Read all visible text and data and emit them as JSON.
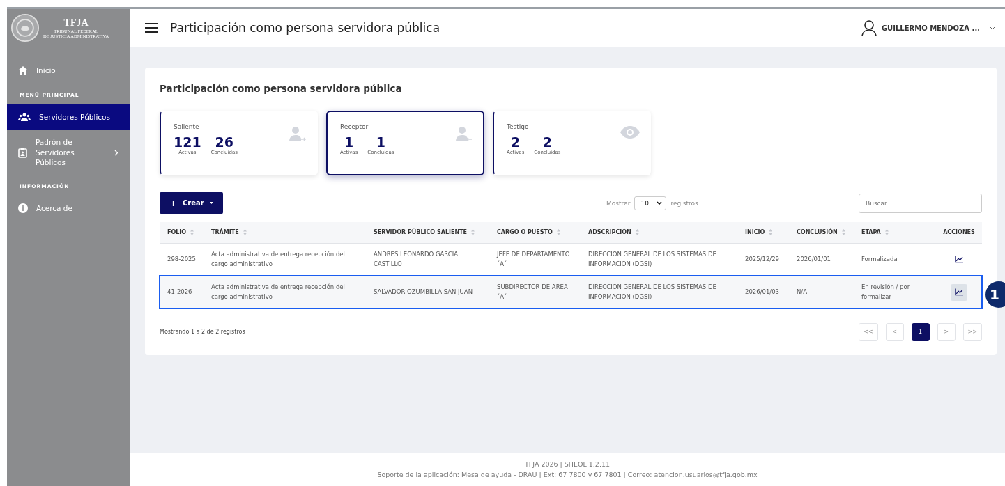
{
  "sidebar": {
    "logo": {
      "title": "TFJA",
      "subtitle_1": "TRIBUNAL FEDERAL",
      "subtitle_2": "DE JUSTICIA ADMINISTRATIVA"
    },
    "items": [
      {
        "kind": "link",
        "label": "Inicio",
        "selected": false
      },
      {
        "kind": "section",
        "label": "MENÚ PRINCIPAL"
      },
      {
        "kind": "link",
        "label": "Servidores Públicos",
        "selected": true
      },
      {
        "kind": "submenu",
        "label": "Padrón de Servidores Públicos",
        "selected": false,
        "expanded": false
      },
      {
        "kind": "section",
        "label": "INFORMACIÓN"
      },
      {
        "kind": "link",
        "label": "Acerca de",
        "selected": false
      }
    ]
  },
  "header": {
    "title": "Participación como persona servidora pública",
    "user": "GUILLERMO MENDOZA ..."
  },
  "card": {
    "title": "Participación como persona servidora pública",
    "stats": [
      {
        "label": "Saliente",
        "selected": false,
        "values": [
          {
            "value": "121",
            "caption": "Activas"
          },
          {
            "value": "26",
            "caption": "Concluidas"
          }
        ]
      },
      {
        "label": "Receptor",
        "selected": true,
        "values": [
          {
            "value": "1",
            "caption": "Activas"
          },
          {
            "value": "1",
            "caption": "Concluidas"
          }
        ]
      },
      {
        "label": "Testigo",
        "selected": false,
        "values": [
          {
            "value": "2",
            "caption": "Activas"
          },
          {
            "value": "2",
            "caption": "Concluidas"
          }
        ]
      }
    ],
    "create_button": {
      "icon": "+",
      "label": "Crear"
    },
    "show": {
      "prefix": "Mostrar",
      "value": "10",
      "suffix": "registros"
    },
    "search": {
      "placeholder": "Buscar..."
    },
    "table": {
      "columns": [
        {
          "label": "FOLIO",
          "sortable": true
        },
        {
          "label": "TRÁMITE",
          "sortable": true
        },
        {
          "label": "SERVIDOR PÚBLICO SALIENTE",
          "sortable": true
        },
        {
          "label": "CARGO O PUESTO",
          "sortable": true
        },
        {
          "label": "ADSCRIPCIÓN",
          "sortable": true
        },
        {
          "label": "INICIO",
          "sortable": true
        },
        {
          "label": "CONCLUSIÓN",
          "sortable": true
        },
        {
          "label": "ETAPA",
          "sortable": true
        },
        {
          "label": "ACCIONES",
          "sortable": false
        }
      ],
      "rows": [
        {
          "selected": false,
          "cells": [
            "298-2025",
            "Acta administrativa de entrega recepción del cargo administrativo",
            "ANDRES LEONARDO GARCIA CASTILLO",
            "JEFE DE DEPARTAMENTO ´A´",
            "DIRECCION GENERAL DE LOS SISTEMAS DE INFORMACION (DGSI)",
            "2025/12/29",
            "2026/01/01",
            "Formalizada"
          ]
        },
        {
          "selected": true,
          "cells": [
            "41-2026",
            "Acta administrativa de entrega recepción del cargo administrativo",
            "SALVADOR OZUMBILLA SAN JUAN",
            "SUBDIRECTOR DE AREA ´A´",
            "DIRECCION GENERAL DE LOS SISTEMAS DE INFORMACION (DGSI)",
            "2026/01/03",
            "N/A",
            "En revisión / por formalizar"
          ]
        }
      ]
    },
    "summary": "Mostrando 1 a 2 de 2 registros",
    "pagination": [
      {
        "label": "<<",
        "selected": false
      },
      {
        "label": "<",
        "selected": false
      },
      {
        "label": "1",
        "selected": true
      },
      {
        "label": ">",
        "selected": false
      },
      {
        "label": ">>",
        "selected": false
      }
    ]
  },
  "annotation": {
    "label": "1"
  },
  "footer": {
    "line_1": "TFJA 2026 | SHEOL 1.2.11",
    "line_2": "Soporte de la aplicación: Mesa de ayuda - DRAU | Ext: 67 7800 y 67 7801 | Correo: atencion.usuarios@tfja.gob.mx"
  }
}
